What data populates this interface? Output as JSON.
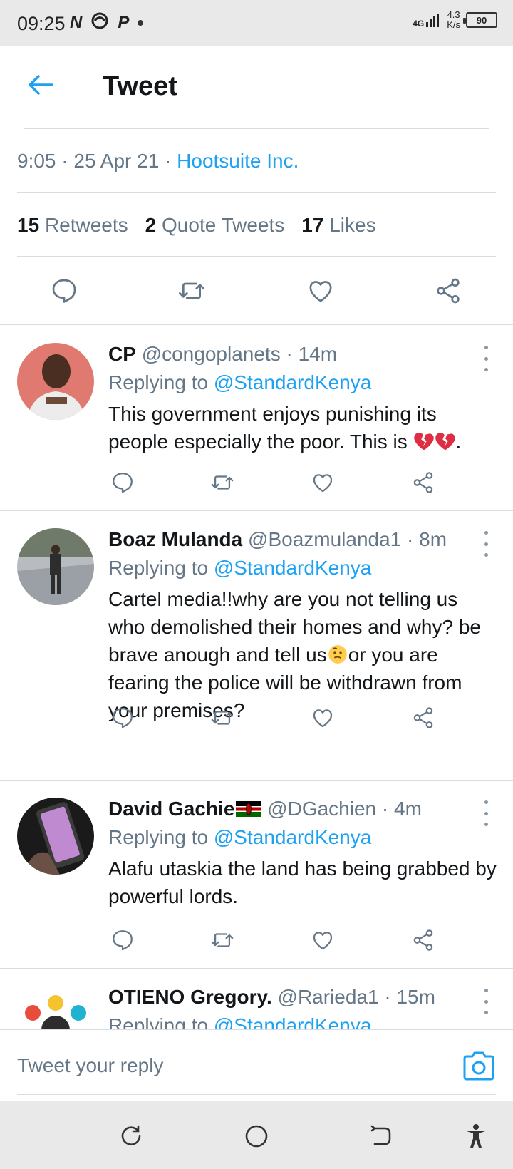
{
  "status_bar": {
    "time": "09:25",
    "network": "4G",
    "speed": "4.3",
    "speed_unit": "K/s",
    "battery": "90"
  },
  "header": {
    "title": "Tweet"
  },
  "tweet": {
    "time": "9:05",
    "date": "25 Apr 21",
    "source": "Hootsuite Inc.",
    "retweets_count": "15",
    "retweets_label": "Retweets",
    "quotes_count": "2",
    "quotes_label": "Quote Tweets",
    "likes_count": "17",
    "likes_label": "Likes"
  },
  "replies": [
    {
      "name": "CP",
      "handle": "@congoplanets",
      "age": "14m",
      "replying_prefix": "Replying to",
      "replying_to": "@StandardKenya",
      "text": "This government enjoys punishing its people especially the poor. This is",
      "text_suffix": "."
    },
    {
      "name": "Boaz Mulanda",
      "handle": "@Boazmulanda1",
      "age": "8m",
      "replying_prefix": "Replying to",
      "replying_to": "@StandardKenya",
      "text_a": "Cartel media!!why are you not telling us who demolished their homes and why? be brave anough and tell us",
      "text_b": "or you are fearing the police will be withdrawn from your premises?"
    },
    {
      "name": "David Gachie",
      "handle": "@DGachien",
      "age": "4m",
      "replying_prefix": "Replying to",
      "replying_to": "@StandardKenya",
      "text": "Alafu utaskia the land has being grabbed by powerful lords."
    },
    {
      "name": "OTIENO Gregory.",
      "handle": "@Rarieda1",
      "age": "15m",
      "replying_prefix": "Replying to",
      "replying_to": "@StandardKenya"
    }
  ],
  "composer": {
    "placeholder": "Tweet your reply"
  },
  "colors": {
    "accent": "#1da1f2",
    "muted": "#657786",
    "text": "#14171a",
    "divider": "#d8dde1"
  }
}
